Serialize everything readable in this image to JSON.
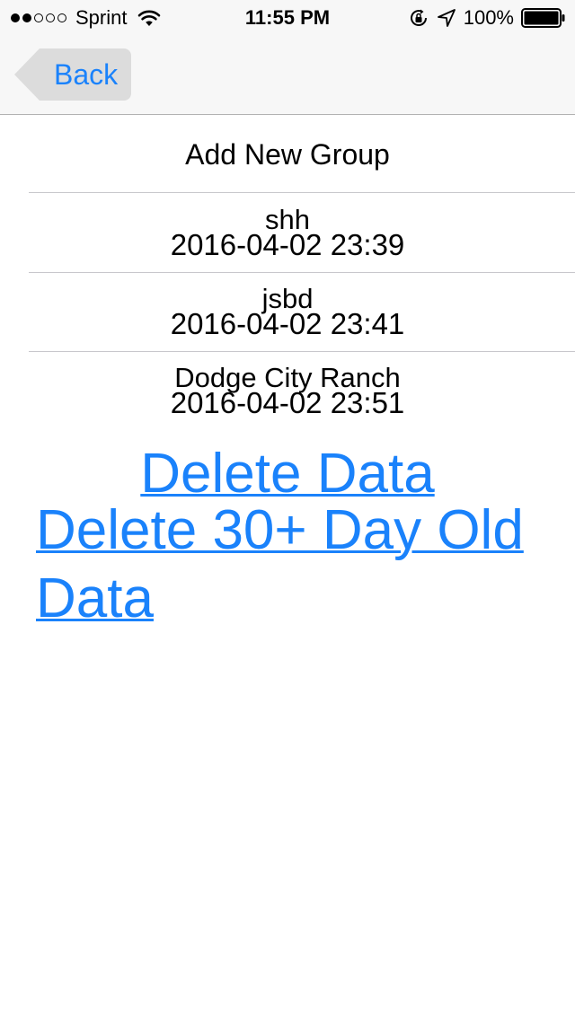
{
  "status_bar": {
    "carrier": "Sprint",
    "time": "11:55 PM",
    "battery_percent": "100%",
    "signal_strength": 2,
    "signal_max": 5,
    "icons": [
      "wifi-icon",
      "rotation-lock-icon",
      "location-arrow-icon",
      "battery-icon"
    ]
  },
  "nav": {
    "back_label": "Back"
  },
  "list": {
    "add_group_label": "Add New Group",
    "groups": [
      {
        "name": "shh",
        "date": "2016-04-02 23:39"
      },
      {
        "name": "jsbd",
        "date": "2016-04-02 23:41"
      },
      {
        "name": "Dodge City Ranch",
        "date": "2016-04-02 23:51"
      }
    ]
  },
  "actions": {
    "delete_data_label": "Delete Data",
    "delete_old_data_label": "Delete 30+ Day Old Data"
  },
  "colors": {
    "accent": "#1a82fb",
    "bar_background": "#f7f7f7",
    "separator": "#c8c7cc"
  }
}
